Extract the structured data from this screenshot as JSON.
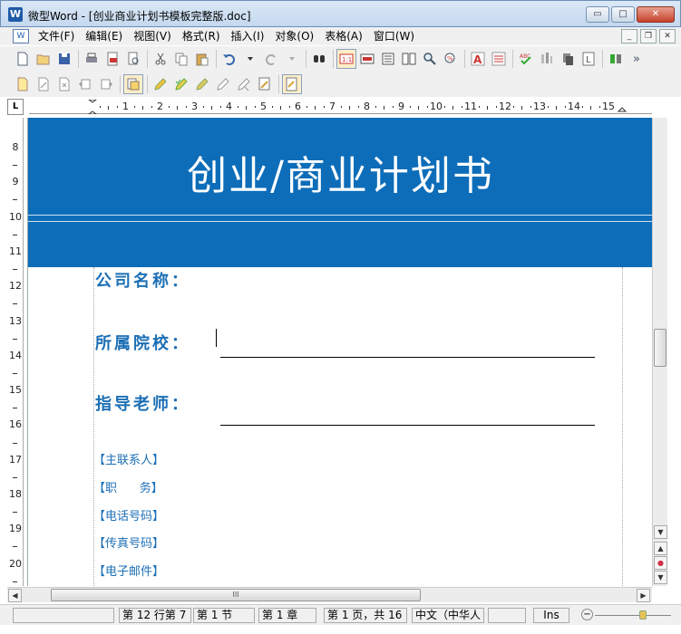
{
  "window": {
    "title": "微型Word - [创业商业计划书模板完整版.doc]",
    "app_icon": "W",
    "buttons": {
      "minimize": "▭",
      "maximize": "□",
      "close": "✕"
    }
  },
  "menu": {
    "doc_icon": "W",
    "items": [
      "文件(F)",
      "编辑(E)",
      "视图(V)",
      "格式(R)",
      "插入(I)",
      "对象(O)",
      "表格(A)",
      "窗口(W)"
    ],
    "mdi": {
      "minimize": "_",
      "restore": "❐",
      "close": "✕"
    }
  },
  "toolbar1": {
    "icons": [
      "new-icon",
      "open-icon",
      "save-icon",
      "print-icon",
      "pdf-icon",
      "print-preview-icon",
      "cut-icon",
      "copy-icon",
      "paste-icon",
      "undo-icon",
      "redo-icon",
      "find-icon",
      "zoom-page-icon",
      "page-view-icon",
      "outline-icon",
      "two-page-icon",
      "zoom-icon",
      "zoom-custom-icon",
      "font-icon",
      "paragraph-icon",
      "spellcheck-icon",
      "columns-icon",
      "shading-icon",
      "border-icon",
      "tools-icon"
    ],
    "overflow": "»"
  },
  "toolbar2": {
    "icons": [
      "annotate-icon",
      "edit-note-icon",
      "delete-note-icon",
      "prev-note-icon",
      "next-note-icon",
      "track-changes-icon",
      "accept-icon",
      "accept-all-icon",
      "reject-icon",
      "reject-all-icon",
      "review-icon",
      "review-pane-icon"
    ]
  },
  "ruler": {
    "corner": "L",
    "h_numbers": [
      "1",
      "2",
      "3",
      "4",
      "5",
      "6",
      "7",
      "8",
      "9",
      "10",
      "11",
      "12",
      "13",
      "14",
      "15"
    ],
    "v_numbers": [
      "8",
      "9",
      "10",
      "11",
      "12",
      "13",
      "14",
      "15",
      "16",
      "17",
      "18",
      "19",
      "20"
    ]
  },
  "document": {
    "title": "创业/商业计划书",
    "fields": {
      "company": "公司名称：",
      "school": "所属院校：",
      "advisor": "指导老师："
    },
    "contacts": [
      "【主联系人】",
      "【职      务】",
      "【电话号码】",
      "【传真号码】",
      "【电子邮件】"
    ]
  },
  "scrollbar": {
    "up": "▲",
    "down": "▼",
    "prev_page": "▲",
    "browse": "●",
    "next_page": "▼",
    "left": "◀",
    "right": "▶",
    "grip": "III"
  },
  "status": {
    "line_col": "第 12 行第 7",
    "section": "第 1 节",
    "chapter": "第 1 章",
    "page": "第 1 页，共 16",
    "language": "中文（中华人",
    "mode": "Ins",
    "zoom_minus": "−"
  },
  "colors": {
    "banner": "#0d6db9",
    "field_text": "#1c6fb5"
  }
}
